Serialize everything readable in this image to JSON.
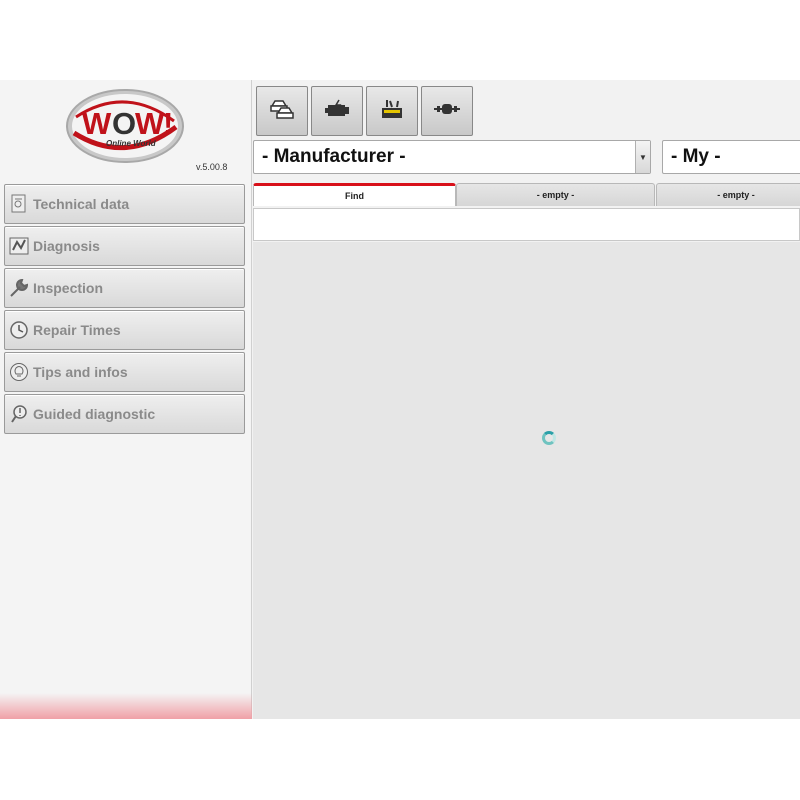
{
  "app": {
    "logo_text": "WOW!",
    "logo_tagline": "Online World",
    "version": "v.5.00.8"
  },
  "colors": {
    "accent": "#d8101a",
    "sidebar_label": "#8a8a8a",
    "content_bg": "#e6e6e6",
    "spinner": "#2aa0a8"
  },
  "toolbar": {
    "buttons": [
      {
        "icon": "cars-icon"
      },
      {
        "icon": "engine-icon"
      },
      {
        "icon": "toolbox-icon"
      },
      {
        "icon": "axle-icon"
      }
    ]
  },
  "selectors": {
    "manufacturer": "- Manufacturer -",
    "model": "- My -"
  },
  "tabs": [
    {
      "label": "Find",
      "active": true
    },
    {
      "label": "- empty -",
      "active": false
    },
    {
      "label": "- empty -",
      "active": false
    }
  ],
  "find": {
    "value": ""
  },
  "sidebar": {
    "items": [
      {
        "label": "Technical data",
        "icon": "document-icon"
      },
      {
        "label": "Diagnosis",
        "icon": "diagnosis-icon"
      },
      {
        "label": "Inspection",
        "icon": "wrench-icon"
      },
      {
        "label": "Repair Times",
        "icon": "clock-icon"
      },
      {
        "label": "Tips and infos",
        "icon": "lightbulb-icon"
      },
      {
        "label": "Guided diagnostic",
        "icon": "guided-diagnostic-icon"
      }
    ]
  },
  "status": {
    "loading": true
  }
}
